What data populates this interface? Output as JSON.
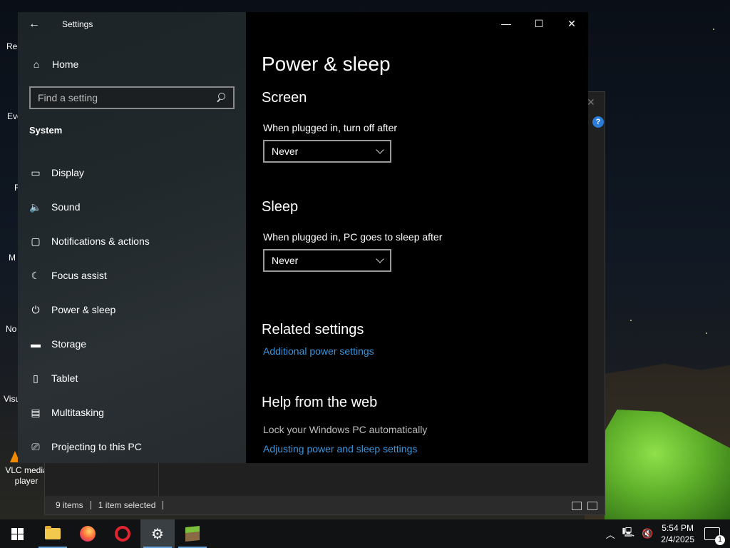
{
  "desktop": {
    "icons": [
      "Rec",
      "Eve",
      "F",
      "M",
      "No",
      "Visu"
    ],
    "vlc_label": "VLC media player"
  },
  "explorer": {
    "status_items": "9 items",
    "status_selected": "1 item selected",
    "help": "?"
  },
  "settings": {
    "app_title": "Settings",
    "home_label": "Home",
    "search_placeholder": "Find a setting",
    "section_title": "System",
    "nav": [
      {
        "label": "Display",
        "icon": "display-icon"
      },
      {
        "label": "Sound",
        "icon": "sound-icon"
      },
      {
        "label": "Notifications & actions",
        "icon": "notifications-icon"
      },
      {
        "label": "Focus assist",
        "icon": "moon-icon"
      },
      {
        "label": "Power & sleep",
        "icon": "power-icon"
      },
      {
        "label": "Storage",
        "icon": "storage-icon"
      },
      {
        "label": "Tablet",
        "icon": "tablet-icon"
      },
      {
        "label": "Multitasking",
        "icon": "multitasking-icon"
      },
      {
        "label": "Projecting to this PC",
        "icon": "projecting-icon"
      }
    ],
    "page_title": "Power & sleep",
    "screen_heading": "Screen",
    "screen_label": "When plugged in, turn off after",
    "screen_value": "Never",
    "sleep_heading": "Sleep",
    "sleep_label": "When plugged in, PC goes to sleep after",
    "sleep_value": "Never",
    "related_heading": "Related settings",
    "related_link": "Additional power settings",
    "help_heading": "Help from the web",
    "help_text": "Lock your Windows PC automatically",
    "help_link": "Adjusting power and sleep settings",
    "accent_link_color": "#3a96dd"
  },
  "taskbar": {
    "apps": [
      "start-button",
      "file-explorer",
      "firefox",
      "opera",
      "settings",
      "minecraft"
    ],
    "time": "5:54 PM",
    "date": "2/4/2025",
    "notification_count": "1"
  }
}
